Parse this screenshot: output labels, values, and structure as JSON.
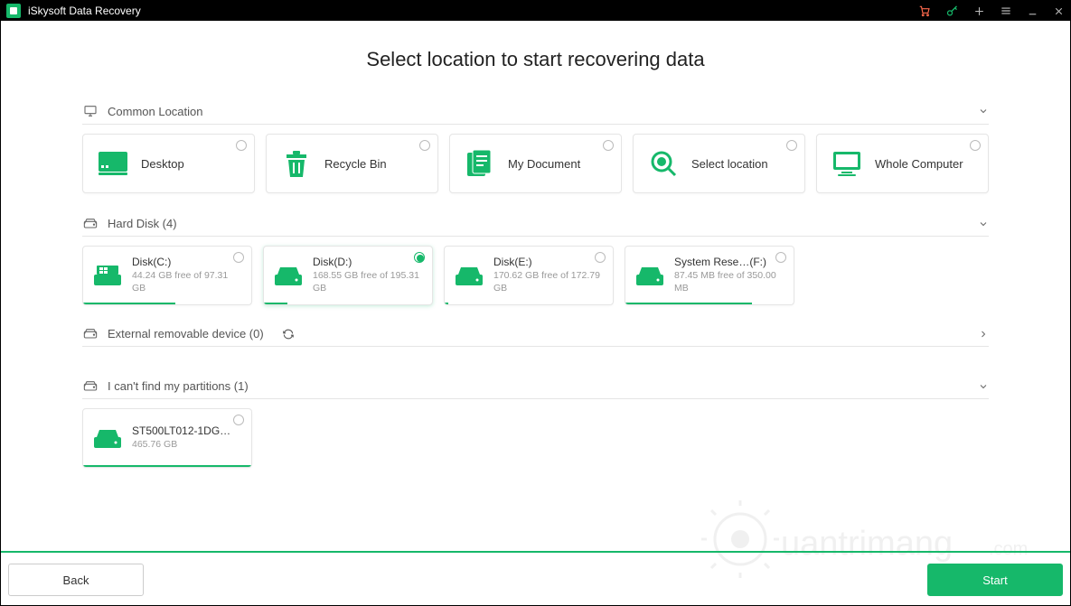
{
  "app": {
    "title": "iSkysoft Data Recovery"
  },
  "page": {
    "heading": "Select location to start recovering data"
  },
  "sections": {
    "common": {
      "label": "Common Location",
      "items": [
        {
          "label": "Desktop"
        },
        {
          "label": "Recycle Bin"
        },
        {
          "label": "My Document"
        },
        {
          "label": "Select location"
        },
        {
          "label": "Whole Computer"
        }
      ]
    },
    "hard_disk": {
      "label": "Hard Disk (4)",
      "items": [
        {
          "name": "Disk(C:)",
          "free": "44.24 GB  free of 97.31 GB",
          "fill_pct": 55
        },
        {
          "name": "Disk(D:)",
          "free": "168.55 GB  free of 195.31 GB",
          "fill_pct": 14,
          "selected": true
        },
        {
          "name": "Disk(E:)",
          "free": "170.62 GB  free of 172.79 GB",
          "fill_pct": 2
        },
        {
          "name": "System Rese…(F:)",
          "free": "87.45 MB  free of 350.00 MB",
          "fill_pct": 75
        }
      ]
    },
    "removable": {
      "label": "External removable device (0)"
    },
    "lost": {
      "label": "I can't find my partitions (1)",
      "items": [
        {
          "name": "ST500LT012-1DG1…",
          "free": "465.76 GB",
          "fill_pct": 100
        }
      ]
    }
  },
  "footer": {
    "back": "Back",
    "start": "Start"
  },
  "watermark": "Quantrimang.com"
}
